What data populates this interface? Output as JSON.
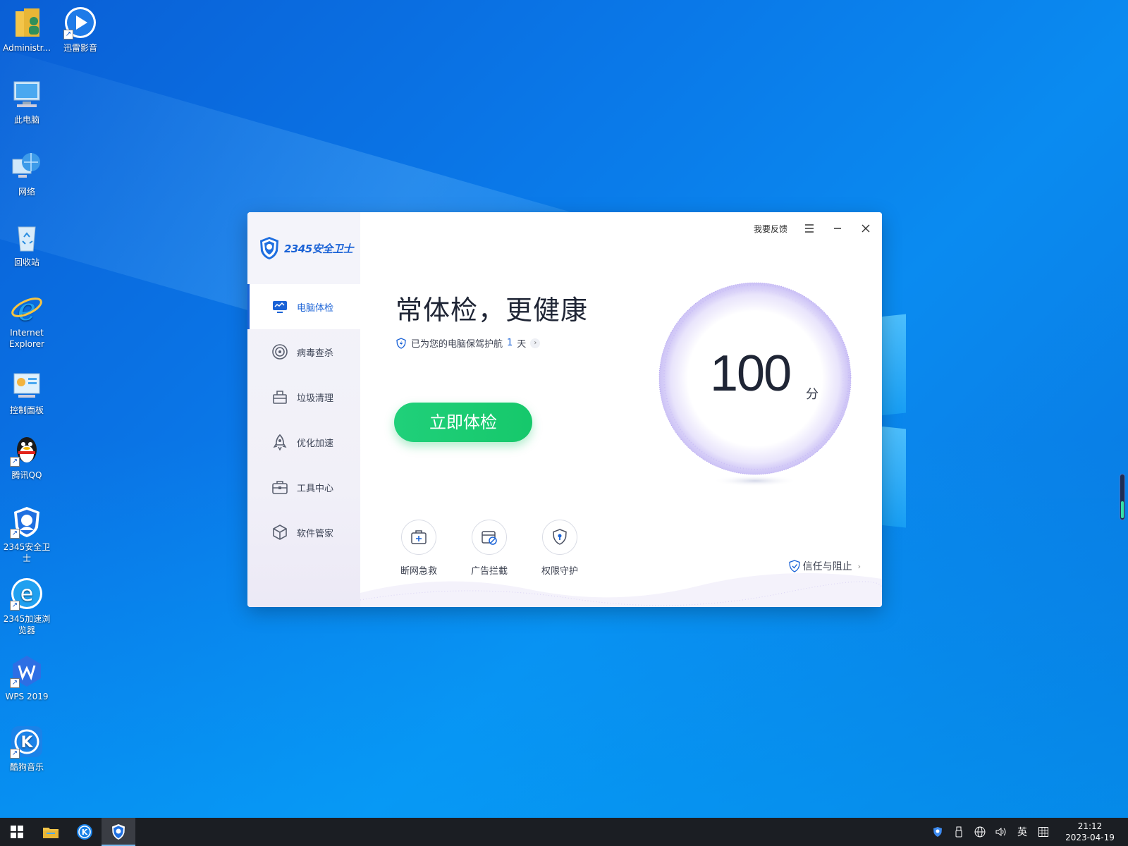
{
  "desktop": {
    "icons": [
      {
        "label": "Administr...",
        "icon": "user-folder-icon"
      },
      {
        "label": "迅雷影音",
        "icon": "xunlei-player-icon"
      },
      {
        "label": "此电脑",
        "icon": "computer-icon"
      },
      {
        "label": "网络",
        "icon": "network-icon"
      },
      {
        "label": "回收站",
        "icon": "recycle-bin-icon"
      },
      {
        "label": "Internet Explorer",
        "icon": "ie-icon"
      },
      {
        "label": "控制面板",
        "icon": "control-panel-icon"
      },
      {
        "label": "腾讯QQ",
        "icon": "qq-icon"
      },
      {
        "label": "2345安全卫士",
        "icon": "2345-guard-icon"
      },
      {
        "label": "2345加速浏览器",
        "icon": "2345-browser-icon"
      },
      {
        "label": "WPS 2019",
        "icon": "wps-icon"
      },
      {
        "label": "酷狗音乐",
        "icon": "kugou-icon"
      }
    ]
  },
  "app": {
    "logo_text": "2345安全卫士",
    "feedback_label": "我要反馈",
    "nav": [
      {
        "label": "电脑体检",
        "icon": "monitor-icon",
        "active": true
      },
      {
        "label": "病毒查杀",
        "icon": "target-icon"
      },
      {
        "label": "垃圾清理",
        "icon": "trash-bag-icon"
      },
      {
        "label": "优化加速",
        "icon": "rocket-icon"
      },
      {
        "label": "工具中心",
        "icon": "toolbox-icon"
      },
      {
        "label": "软件管家",
        "icon": "package-icon"
      }
    ],
    "headline": "常体检，更健康",
    "guard": {
      "text": "已为您的电脑保驾护航",
      "days": "1",
      "unit": "天"
    },
    "scan_button": "立即体检",
    "score": {
      "value": "100",
      "unit": "分"
    },
    "tools": [
      {
        "label": "断网急救",
        "icon": "first-aid-icon"
      },
      {
        "label": "广告拦截",
        "icon": "ad-block-icon"
      },
      {
        "label": "权限守护",
        "icon": "shield-lock-icon"
      }
    ],
    "trust_label": "信任与阻止"
  },
  "taskbar": {
    "tray_ime": "英",
    "time": "21:12",
    "date": "2023-04-19"
  },
  "colors": {
    "accent": "#1a62d6",
    "green": "#1ecb72",
    "taskbar": "#1b1e23"
  }
}
